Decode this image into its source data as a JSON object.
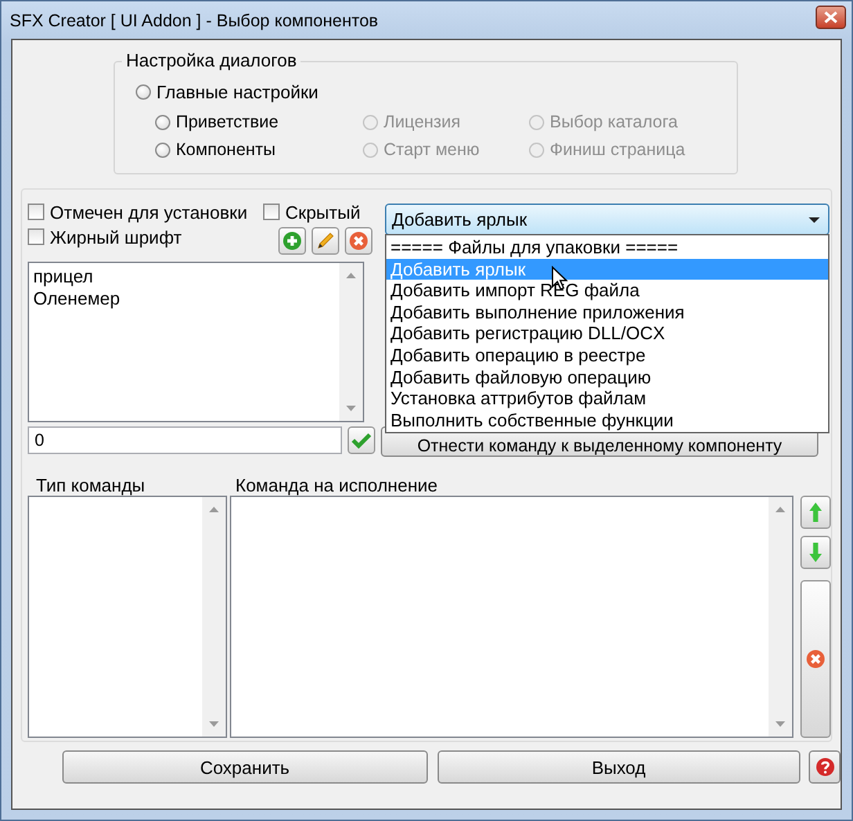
{
  "window": {
    "title": "SFX Creator [ UI Addon ] - Выбор компонентов"
  },
  "dialog_settings": {
    "title": "Настройка диалогов",
    "main_option": {
      "label": "Главные настройки",
      "selected": false,
      "disabled": false
    },
    "options": [
      {
        "label": "Приветствие",
        "selected": false,
        "disabled": false
      },
      {
        "label": "Лицензия",
        "selected": false,
        "disabled": true
      },
      {
        "label": "Выбор каталога",
        "selected": false,
        "disabled": true
      },
      {
        "label": "Компоненты",
        "selected": false,
        "disabled": false
      },
      {
        "label": "Старт меню",
        "selected": false,
        "disabled": true
      },
      {
        "label": "Финиш страница",
        "selected": false,
        "disabled": true
      }
    ]
  },
  "component_flags": [
    {
      "label": "Отмечен для установки",
      "checked": false
    },
    {
      "label": "Скрытый",
      "checked": false
    },
    {
      "label": "Жирный шрифт",
      "checked": false
    }
  ],
  "components": [
    "прицел",
    "Оленемер"
  ],
  "number_field": {
    "value": "0"
  },
  "command_select": {
    "value": "Добавить ярлык",
    "expanded": true,
    "options": [
      {
        "label": "===== Файлы для упаковки =====",
        "selected": false
      },
      {
        "label": "Добавить ярлык",
        "selected": true
      },
      {
        "label": "Добавить импорт REG файла",
        "selected": false
      },
      {
        "label": "Добавить выполнение приложения",
        "selected": false
      },
      {
        "label": "Добавить регистрацию DLL/OCX",
        "selected": false
      },
      {
        "label": "Добавить операцию в реестре",
        "selected": false
      },
      {
        "label": "Добавить файловую операцию",
        "selected": false
      },
      {
        "label": "Установка аттрибутов файлам",
        "selected": false
      },
      {
        "label": "Выполнить собственные функции",
        "selected": false
      }
    ]
  },
  "assign_button": "Отнести команду к выделенному компоненту",
  "command_type_label": "Тип команды",
  "command_label": "Команда на исполнение",
  "buttons": [
    "Сохранить",
    "Выход"
  ]
}
